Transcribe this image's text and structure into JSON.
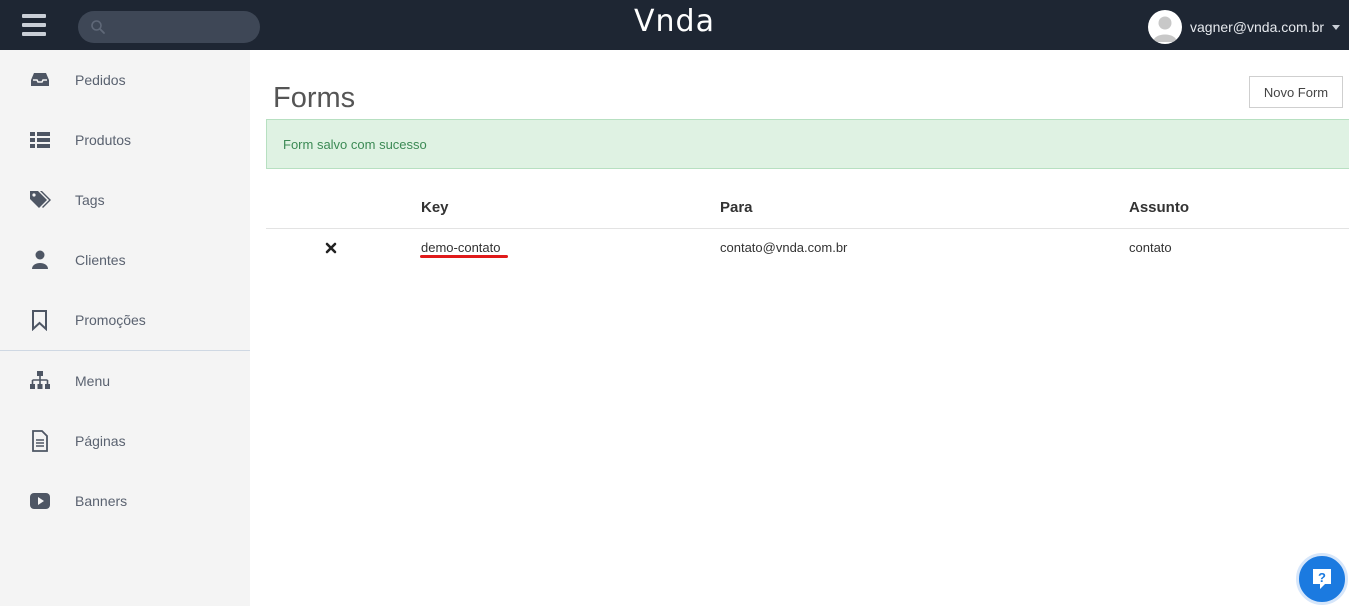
{
  "header": {
    "brand": "Vnda",
    "search_placeholder": "",
    "user_email": "vagner@vnda.com.br",
    "background": "#1e2633"
  },
  "sidebar": {
    "items": [
      {
        "label": "Pedidos",
        "icon": "inbox-icon"
      },
      {
        "label": "Produtos",
        "icon": "list-icon"
      },
      {
        "label": "Tags",
        "icon": "tags-icon"
      },
      {
        "label": "Clientes",
        "icon": "user-icon"
      },
      {
        "label": "Promoções",
        "icon": "bookmark-icon"
      },
      {
        "label": "Menu",
        "icon": "sitemap-icon"
      },
      {
        "label": "Páginas",
        "icon": "file-text-icon"
      },
      {
        "label": "Banners",
        "icon": "play-icon"
      }
    ]
  },
  "main": {
    "title": "Forms",
    "new_button": "Novo Form",
    "alert": "Form salvo com sucesso",
    "table": {
      "headers": [
        "Key",
        "Para",
        "Assunto"
      ],
      "rows": [
        {
          "key": "demo-contato",
          "para": "contato@vnda.com.br",
          "assunto": "contato"
        }
      ]
    }
  },
  "colors": {
    "accent": "#1b7ae0",
    "success_bg": "#dff2e3",
    "success_text": "#3c8a55",
    "annotation": "#e01a1a"
  }
}
